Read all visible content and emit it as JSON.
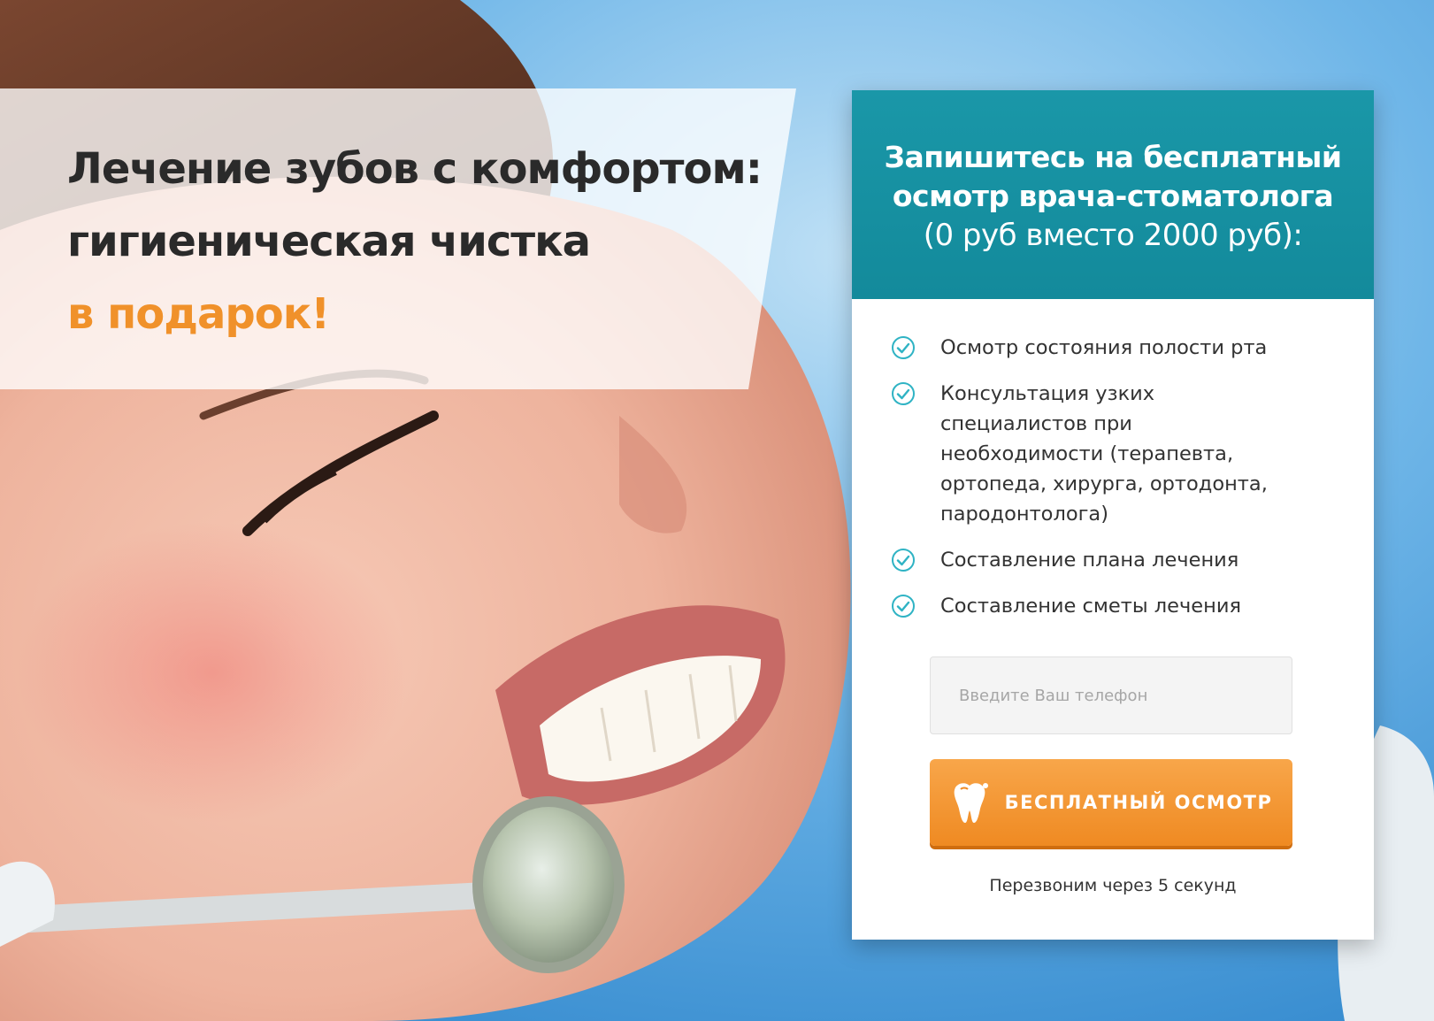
{
  "hero": {
    "headline_line1": "Лечение зубов с комфортом:",
    "headline_line2": "гигиеническая чистка",
    "headline_accent": "в подарок!",
    "accent_color": "#f0912a",
    "text_color": "#2a2a2a"
  },
  "form_card": {
    "header_line1": "Запишитесь на бесплатный",
    "header_line2": "осмотр врача-стоматолога",
    "header_line3": "(0 руб вместо 2000 руб):",
    "header_color": "#1a97a8",
    "features": [
      {
        "label": "Осмотр состояния полости рта",
        "icon": "check-circle-icon"
      },
      {
        "label": "Консультация узких специалистов при необходимости (терапевта, ортопеда, хирурга, ортодонта, пародонтолога)",
        "icon": "check-circle-icon"
      },
      {
        "label": "Составление плана лечения",
        "icon": "check-circle-icon"
      },
      {
        "label": "Составление сметы лечения",
        "icon": "check-circle-icon"
      }
    ],
    "phone_placeholder": "Введите Ваш телефон",
    "phone_value": "",
    "cta_label": "БЕСПЛАТНЫЙ ОСМОТР",
    "cta_icon": "tooth-icon",
    "cta_color": "#ef8a22",
    "callback_note": "Перезвоним через 5 секунд"
  }
}
